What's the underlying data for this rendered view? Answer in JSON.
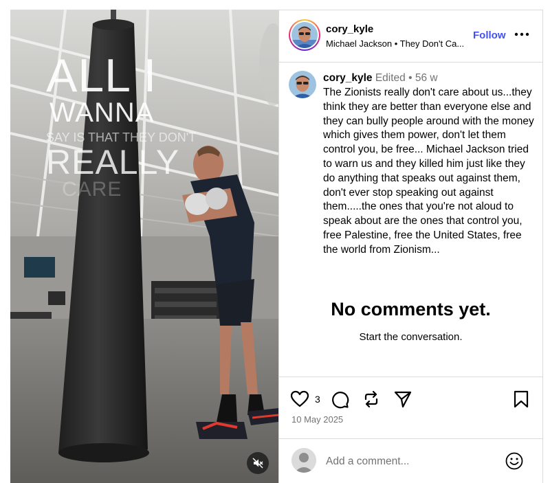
{
  "media": {
    "overlay_lines": [
      "ALL I",
      "WANNA",
      "SAY IS THAT THEY DON'T",
      "REALLY",
      "CARE"
    ],
    "mute_icon": "speaker-muted-icon"
  },
  "header": {
    "username": "cory_kyle",
    "audio": "Michael Jackson • They Don't Ca...",
    "follow_label": "Follow",
    "more_icon": "more-horizontal-icon"
  },
  "caption": {
    "username": "cory_kyle",
    "meta": " Edited • 56 w",
    "text": "The Zionists really don't care about us...they think they are better than everyone else and they can bully people around with the money which gives them power, don't let them control you, be free... Michael Jackson tried to warn us and they killed him just like they do anything that speaks out against them, don't ever stop speaking out against them.....the ones that you're not aloud to speak about are the ones that control you, free Palestine, free the United States, free the world from Zionism..."
  },
  "comments": {
    "empty_title": "No comments yet.",
    "empty_subtitle": "Start the conversation."
  },
  "actions": {
    "like_count": "3",
    "date": "10 May 2025",
    "icons": [
      "heart-icon",
      "comment-icon",
      "repost-icon",
      "share-icon",
      "bookmark-icon"
    ]
  },
  "comment_bar": {
    "placeholder": "Add a comment...",
    "emoji_icon": "emoji-icon"
  },
  "colors": {
    "follow": "#4150f7",
    "muted_text": "#737373",
    "divider": "#dbdbdb"
  }
}
